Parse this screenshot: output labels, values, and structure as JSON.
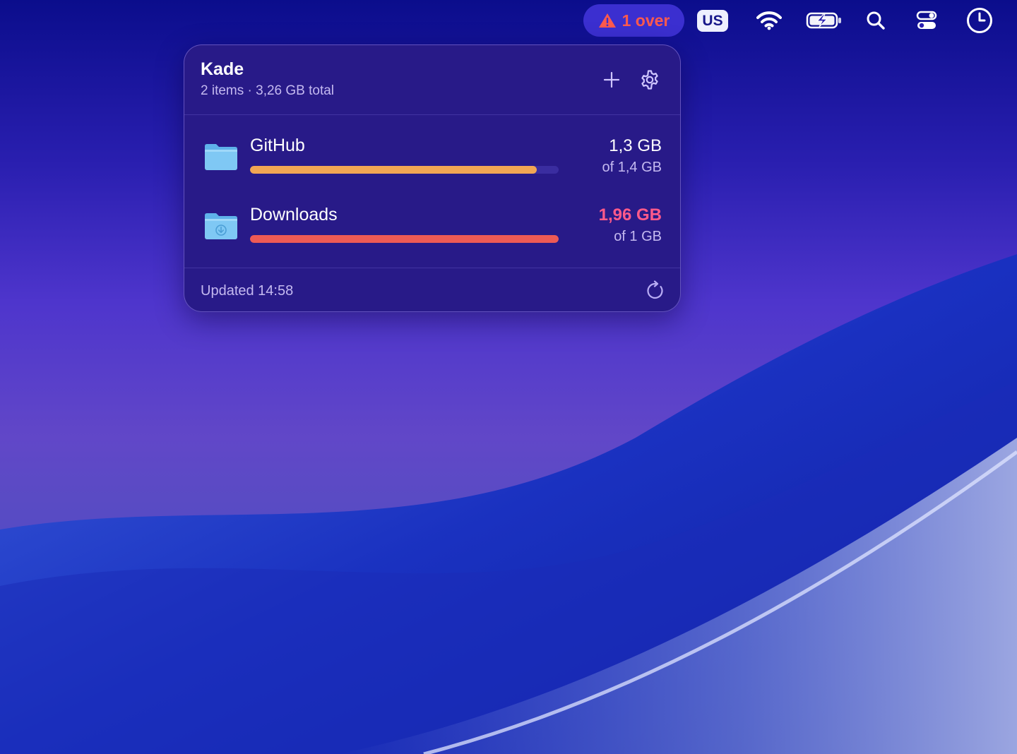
{
  "menubar": {
    "over_alert": {
      "text": "1 over",
      "color": "#ff5a4e"
    },
    "input_source": "US",
    "icons": [
      "warning-icon",
      "wifi-icon",
      "battery-charging-icon",
      "search-icon",
      "control-center-icon",
      "clock-icon"
    ]
  },
  "panel": {
    "title": "Kade",
    "subtitle": "2 items · 3,26 GB total",
    "items": [
      {
        "name": "GitHub",
        "used": "1,3 GB",
        "quota": "of 1,4 GB",
        "usage_fraction": 0.93,
        "bar_color": "#f2a654",
        "used_color": "#ffffff",
        "icon": "folder-icon"
      },
      {
        "name": "Downloads",
        "used": "1,96 GB",
        "quota": "of 1 GB",
        "usage_fraction": 1.0,
        "bar_color": "#ee5a55",
        "used_color": "#ff5a8a",
        "icon": "downloads-folder-icon"
      }
    ],
    "footer": {
      "updated": "Updated 14:58"
    },
    "icons": [
      "add-icon",
      "gear-icon",
      "refresh-icon"
    ]
  }
}
